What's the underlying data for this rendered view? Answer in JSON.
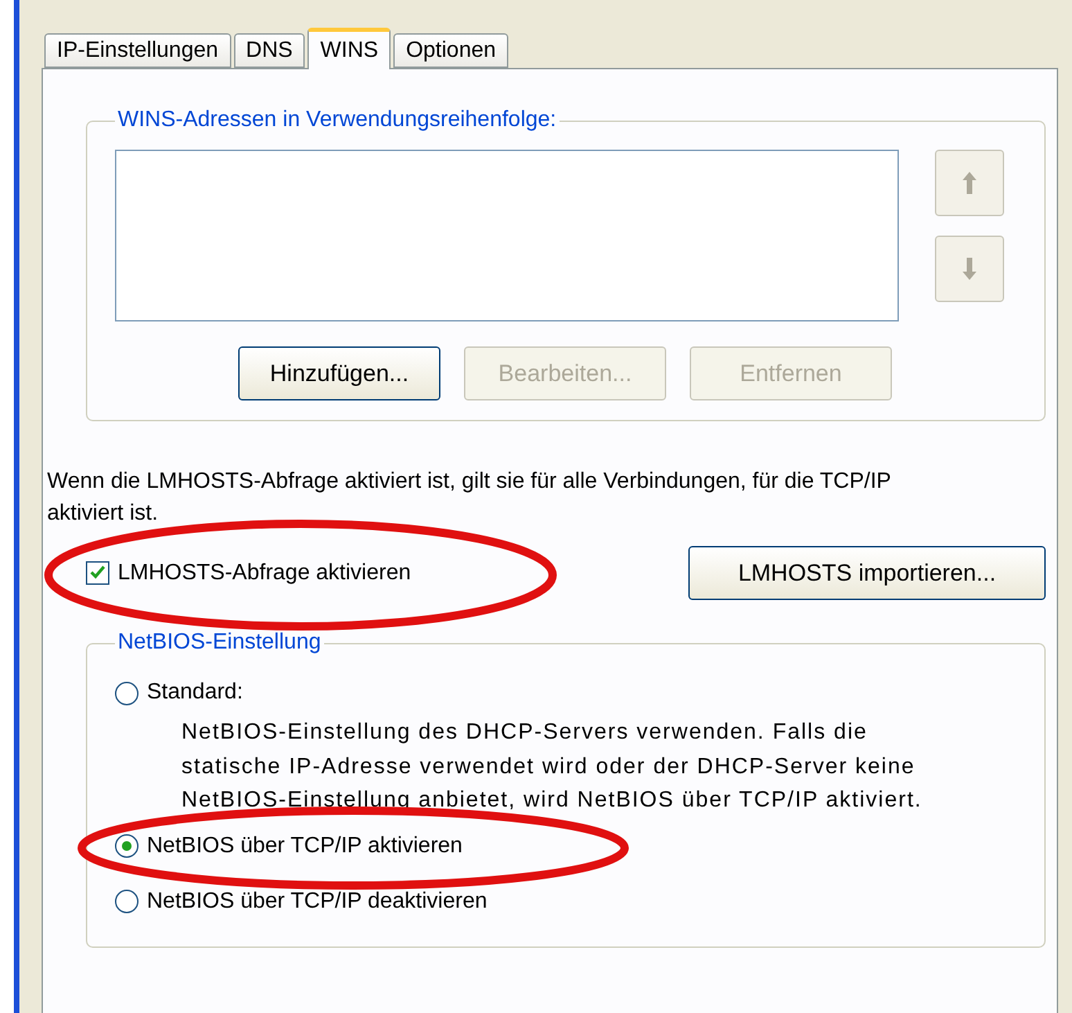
{
  "tabs": [
    {
      "label": "IP-Einstellungen",
      "selected": false
    },
    {
      "label": "DNS",
      "selected": false
    },
    {
      "label": "WINS",
      "selected": true
    },
    {
      "label": "Optionen",
      "selected": false
    }
  ],
  "wins_group": {
    "title": "WINS-Adressen in Verwendungsreihenfolge:",
    "buttons": [
      {
        "label": "Hinzufügen...",
        "disabled": false
      },
      {
        "label": "Bearbeiten...",
        "disabled": true
      },
      {
        "label": "Entfernen",
        "disabled": true
      }
    ]
  },
  "lmhosts_info": "Wenn die LMHOSTS-Abfrage aktiviert ist, gilt sie für alle Verbindungen, für die TCP/IP aktiviert ist.",
  "lmhosts_checkbox": {
    "label": "LMHOSTS-Abfrage aktivieren",
    "checked": true
  },
  "lmhosts_import_button": "LMHOSTS importieren...",
  "netbios_group": {
    "title": "NetBIOS-Einstellung",
    "options": [
      {
        "label": "Standard:",
        "selected": false,
        "description": "NetBIOS-Einstellung des DHCP-Servers verwenden. Falls die statische IP-Adresse verwendet wird oder der DHCP-Server keine NetBIOS-Einstellung anbietet, wird NetBIOS über TCP/IP aktiviert."
      },
      {
        "label": "NetBIOS über TCP/IP aktivieren",
        "selected": true
      },
      {
        "label": "NetBIOS über TCP/IP deaktivieren",
        "selected": false
      }
    ]
  }
}
